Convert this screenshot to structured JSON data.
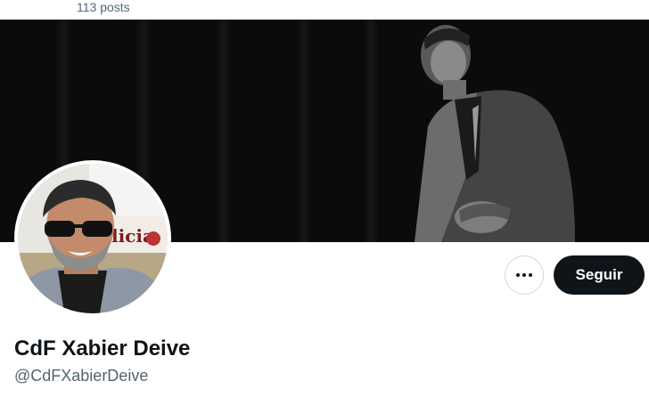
{
  "header": {
    "post_count": "113 posts"
  },
  "profile": {
    "display_name": "CdF Xabier Deive",
    "handle": "@CdFXabierDeive",
    "avatar_sign_text": "Galicia"
  },
  "actions": {
    "more_label": "More",
    "follow_label": "Seguir"
  },
  "colors": {
    "primary_text": "#0f1419",
    "secondary_text": "#536471",
    "follow_button_bg": "#0f1419",
    "border": "#cfd9de",
    "banner_bg": "#0b0b0b"
  },
  "icons": {
    "more": "ellipsis-horizontal-icon"
  }
}
